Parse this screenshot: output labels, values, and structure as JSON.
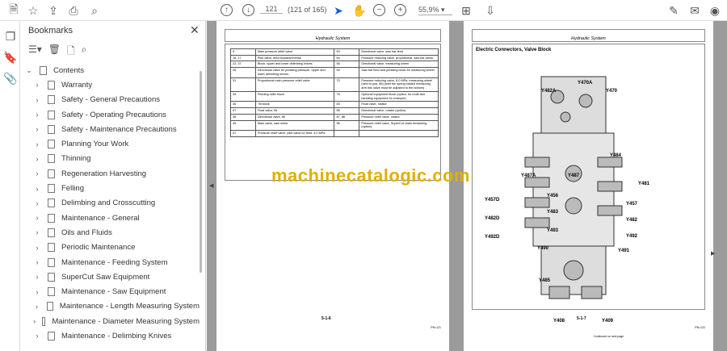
{
  "toolbar": {
    "page_current": "121",
    "page_of": "(121 of 165)",
    "zoom": "55,9%"
  },
  "bookmarks": {
    "title": "Bookmarks",
    "root": "Contents",
    "items": [
      "Warranty",
      "Safety - General Precautions",
      "Safety - Operating Precautions",
      "Safety - Maintenance Precautions",
      "Planning Your Work",
      "Thinning",
      "Regeneration Harvesting",
      "Felling",
      "Delimbing and Crosscutting",
      "Maintenance - General",
      "Oils and Fluids",
      "Periodic Maintenance",
      "Maintenance - Feeding System",
      "SuperCut Saw Equipment",
      "Maintenance - Saw Equipment",
      "Maintenance - Length Measuring System",
      "Maintenance - Diameter Measuring System",
      "Maintenance - Delimbing Knives"
    ]
  },
  "left_page": {
    "header": "Hydraulic System",
    "rows": [
      [
        "9",
        "Main pressure relief valve",
        "63",
        "Directional valve, saw bar feed"
      ],
      [
        "16, 17",
        "Pilot valve, feed forward/reverse",
        "64",
        "Pressure reducing valve, proportional, saw bar press"
      ],
      [
        "22, 37",
        "Block, upper and lower delimbing knives",
        "66",
        "Directional valve, measuring wheel"
      ],
      [
        "26",
        "Directional valve for pressing pressure, upper and lower delimbing knives",
        "69",
        "Saw bar feed and pressing block for measuring wheel"
      ],
      [
        "31",
        "Proportional main pressure relief valve",
        "70",
        "Pressure reducing valve, 8.0 MPa, measuring wheel (next to pos. 66) (with the spring loaded measuring arm this valve must be adjusted to the bottom)"
      ],
      [
        "34",
        "Feeding roller block",
        "76",
        "Optional equipment block (option, for multi-tree handling equipment for example)"
      ],
      [
        "46",
        "Tilt block",
        "83",
        "Float valve, rotator"
      ],
      [
        "47",
        "Float valve, tilt",
        "85",
        "Directional valve, rotator (option)"
      ],
      [
        "48",
        "Directional valve, tilt",
        "87, 88",
        "Pressure relief valve, rotator"
      ],
      [
        "49",
        "Main valve, saw motor",
        "96",
        "Pressure relief valve, SuperCut chain tensioning (option)"
      ],
      [
        "57",
        "Pressure relief valve, pilot valve for feed, 4.0 MPa",
        "",
        ""
      ]
    ],
    "page_number": "5-1-6",
    "page_ref": "PN=121"
  },
  "right_page": {
    "header": "Hydraulic System",
    "title": "Electric Connectors, Valve Block",
    "labels": [
      "Y470A",
      "Y470",
      "Y482A",
      "Y484",
      "Y487A",
      "Y487",
      "Y481",
      "Y457D",
      "Y456",
      "Y457",
      "Y482D",
      "Y483",
      "Y482",
      "Y492D",
      "Y493",
      "Y492",
      "Y490",
      "Y491",
      "Y485",
      "Y408",
      "Y409"
    ],
    "continued": "Continued on next page",
    "page_number": "5-1-7",
    "page_ref": "PN=122"
  },
  "watermark": "machinecatalogic.com"
}
